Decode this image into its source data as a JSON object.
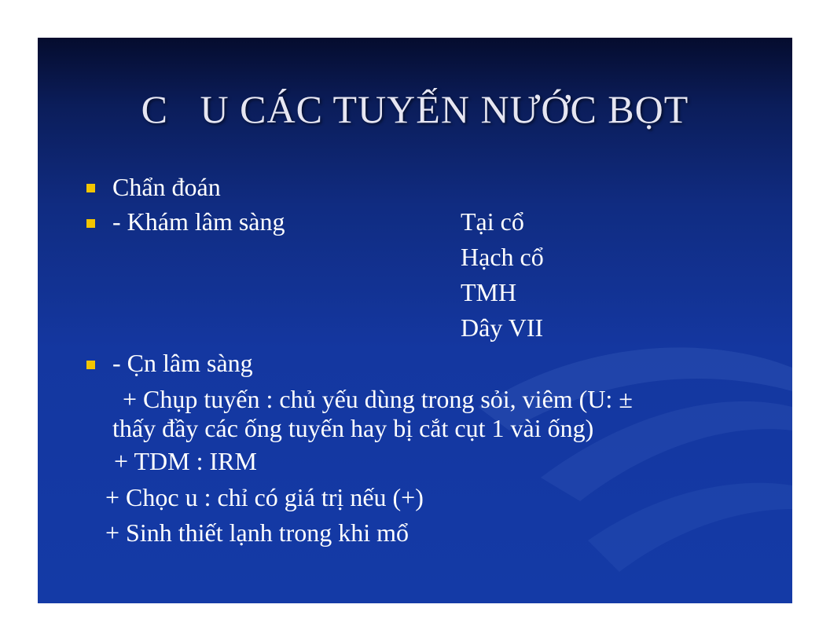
{
  "slide": {
    "title": "C   U CÁC TUYẾN NƯỚC BỌT",
    "bullets": [
      {
        "text": "Chẩn đoán"
      },
      {
        "text": "- Khám lâm sàng"
      },
      {
        "text": "- C̣n lâm sàng"
      }
    ],
    "clinical_items": [
      "Tại cổ",
      "Hạch cổ",
      "TMH",
      "Dây VII"
    ],
    "paraclinical_lines": [
      " + Chụp tuyến : chủ yếu dùng trong sỏi, viêm (U: ±",
      "thấy đầy các ống tuyến hay bị cắt cụt 1 vài ống)",
      "+ TDM : IRM",
      "+ Chọc u : chỉ có giá trị nếu (+)",
      "+ Sinh thiết lạnh trong khi mổ"
    ],
    "colors": {
      "background_top": "#050c2e",
      "background_main": "#143aa6",
      "bullet": "#f2c500",
      "title": "#e6e6f2",
      "text": "#ffffff"
    }
  }
}
